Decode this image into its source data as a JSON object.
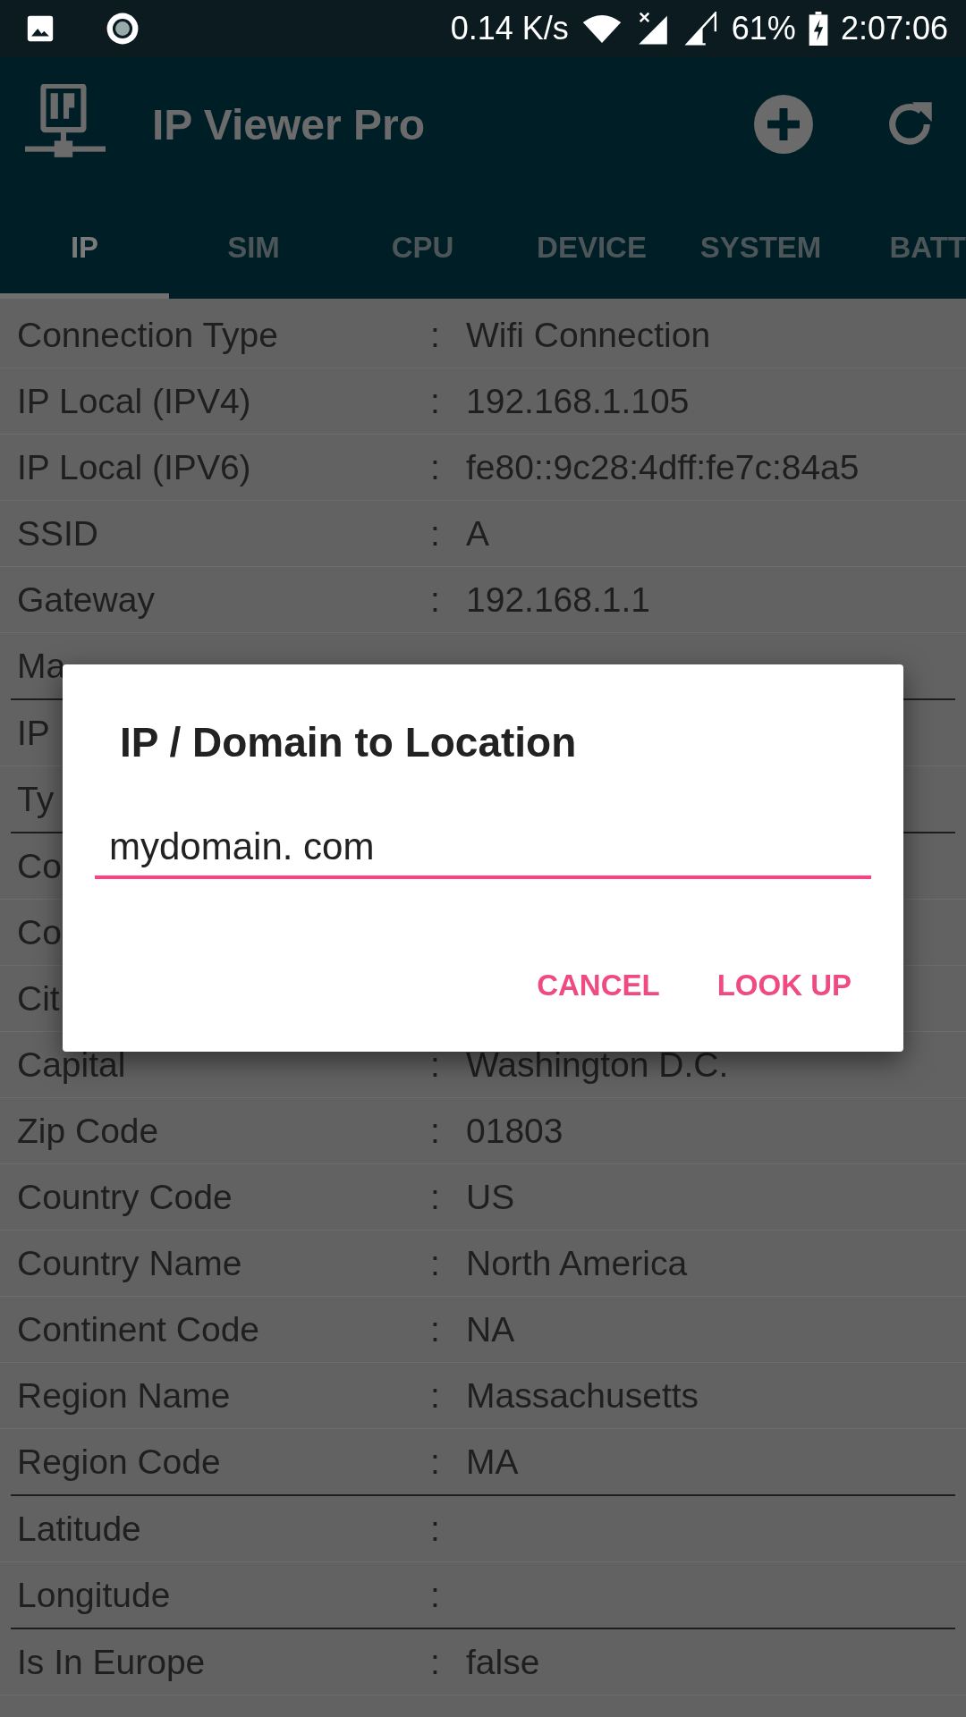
{
  "status_bar": {
    "speed": "0.14 K/s",
    "battery": "61%",
    "time": "2:07:06"
  },
  "app_bar": {
    "title": "IP Viewer Pro"
  },
  "tabs": [
    {
      "label": "IP",
      "selected": true
    },
    {
      "label": "SIM",
      "selected": false
    },
    {
      "label": "CPU",
      "selected": false
    },
    {
      "label": "DEVICE",
      "selected": false
    },
    {
      "label": "SYSTEM",
      "selected": false
    },
    {
      "label": "BATT",
      "selected": false
    }
  ],
  "rows": [
    {
      "label": "Connection Type",
      "separator": ":",
      "value": "Wifi Connection",
      "section_end": false
    },
    {
      "label": "IP Local (IPV4)",
      "separator": ":",
      "value": "192.168.1.105",
      "section_end": false
    },
    {
      "label": "IP Local (IPV6)",
      "separator": ":",
      "value": "fe80::9c28:4dff:fe7c:84a5",
      "section_end": false
    },
    {
      "label": "SSID",
      "separator": ":",
      "value": "A",
      "section_end": false
    },
    {
      "label": "Gateway",
      "separator": ":",
      "value": "192.168.1.1",
      "section_end": false
    },
    {
      "label": "Ma",
      "section_end": true
    },
    {
      "label": "IP",
      "section_end": false
    },
    {
      "label": "Ty",
      "section_end": true
    },
    {
      "label": "Co",
      "section_end": false
    },
    {
      "label": "Co",
      "section_end": false
    },
    {
      "label": "Cit",
      "section_end": false
    },
    {
      "label": "Capital",
      "separator": ":",
      "value": "Washington D.C.",
      "section_end": false
    },
    {
      "label": "Zip Code",
      "separator": ":",
      "value": "01803",
      "section_end": false
    },
    {
      "label": "Country Code",
      "separator": ":",
      "value": "US",
      "section_end": false
    },
    {
      "label": "Country Name",
      "separator": ":",
      "value": "North America",
      "section_end": false
    },
    {
      "label": "Continent Code",
      "separator": ":",
      "value": "NA",
      "section_end": false
    },
    {
      "label": "Region Name",
      "separator": ":",
      "value": "Massachusetts",
      "section_end": false
    },
    {
      "label": "Region Code",
      "separator": ":",
      "value": "MA",
      "section_end": true
    },
    {
      "label": "Latitude",
      "separator": ":",
      "section_end": false
    },
    {
      "label": "Longitude",
      "separator": ":",
      "section_end": true
    },
    {
      "label": "Is In Europe",
      "separator": ":",
      "value": "false",
      "section_end": false
    }
  ],
  "dialog": {
    "title": "IP / Domain to Location",
    "input_value": "mydomain. com",
    "buttons": [
      "CANCEL",
      "LOOK UP"
    ]
  }
}
